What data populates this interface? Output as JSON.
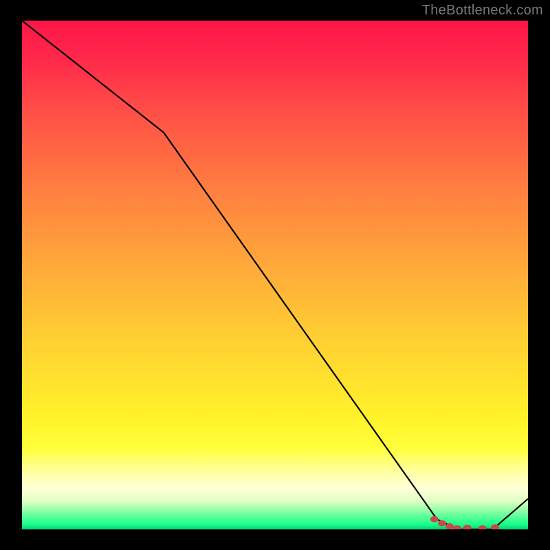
{
  "attribution": "TheBottleneck.com",
  "chart_data": {
    "type": "line",
    "title": "",
    "xlabel": "",
    "ylabel": "",
    "xlim": [
      0,
      100
    ],
    "ylim": [
      0,
      100
    ],
    "series": [
      {
        "name": "curve",
        "x": [
          0,
          28,
          82,
          86,
          93,
          100
        ],
        "values": [
          100,
          78,
          2,
          0,
          0,
          6
        ]
      }
    ],
    "markers": [
      {
        "x": 81.5,
        "y": 2.0
      },
      {
        "x": 83.0,
        "y": 1.2
      },
      {
        "x": 84.5,
        "y": 0.6
      },
      {
        "x": 86.0,
        "y": 0.2
      },
      {
        "x": 88.0,
        "y": 0.3
      },
      {
        "x": 91.0,
        "y": 0.2
      },
      {
        "x": 93.5,
        "y": 0.4
      }
    ],
    "colors": {
      "line": "#000000",
      "marker": "#c64a4a"
    }
  }
}
